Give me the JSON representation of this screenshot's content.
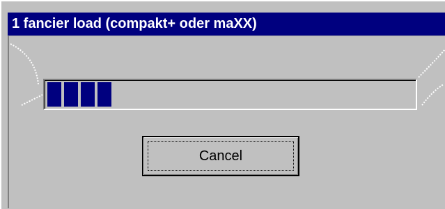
{
  "window": {
    "title": "1 fancier load (compakt+ oder maXX)"
  },
  "progress": {
    "value": 0.18
  },
  "buttons": {
    "cancel_label": "Cancel"
  },
  "colors": {
    "title_bar": "#00007f",
    "title_text": "#ffffff",
    "dialog_face": "#c0c0c0",
    "progress_fill": "#00007f"
  }
}
